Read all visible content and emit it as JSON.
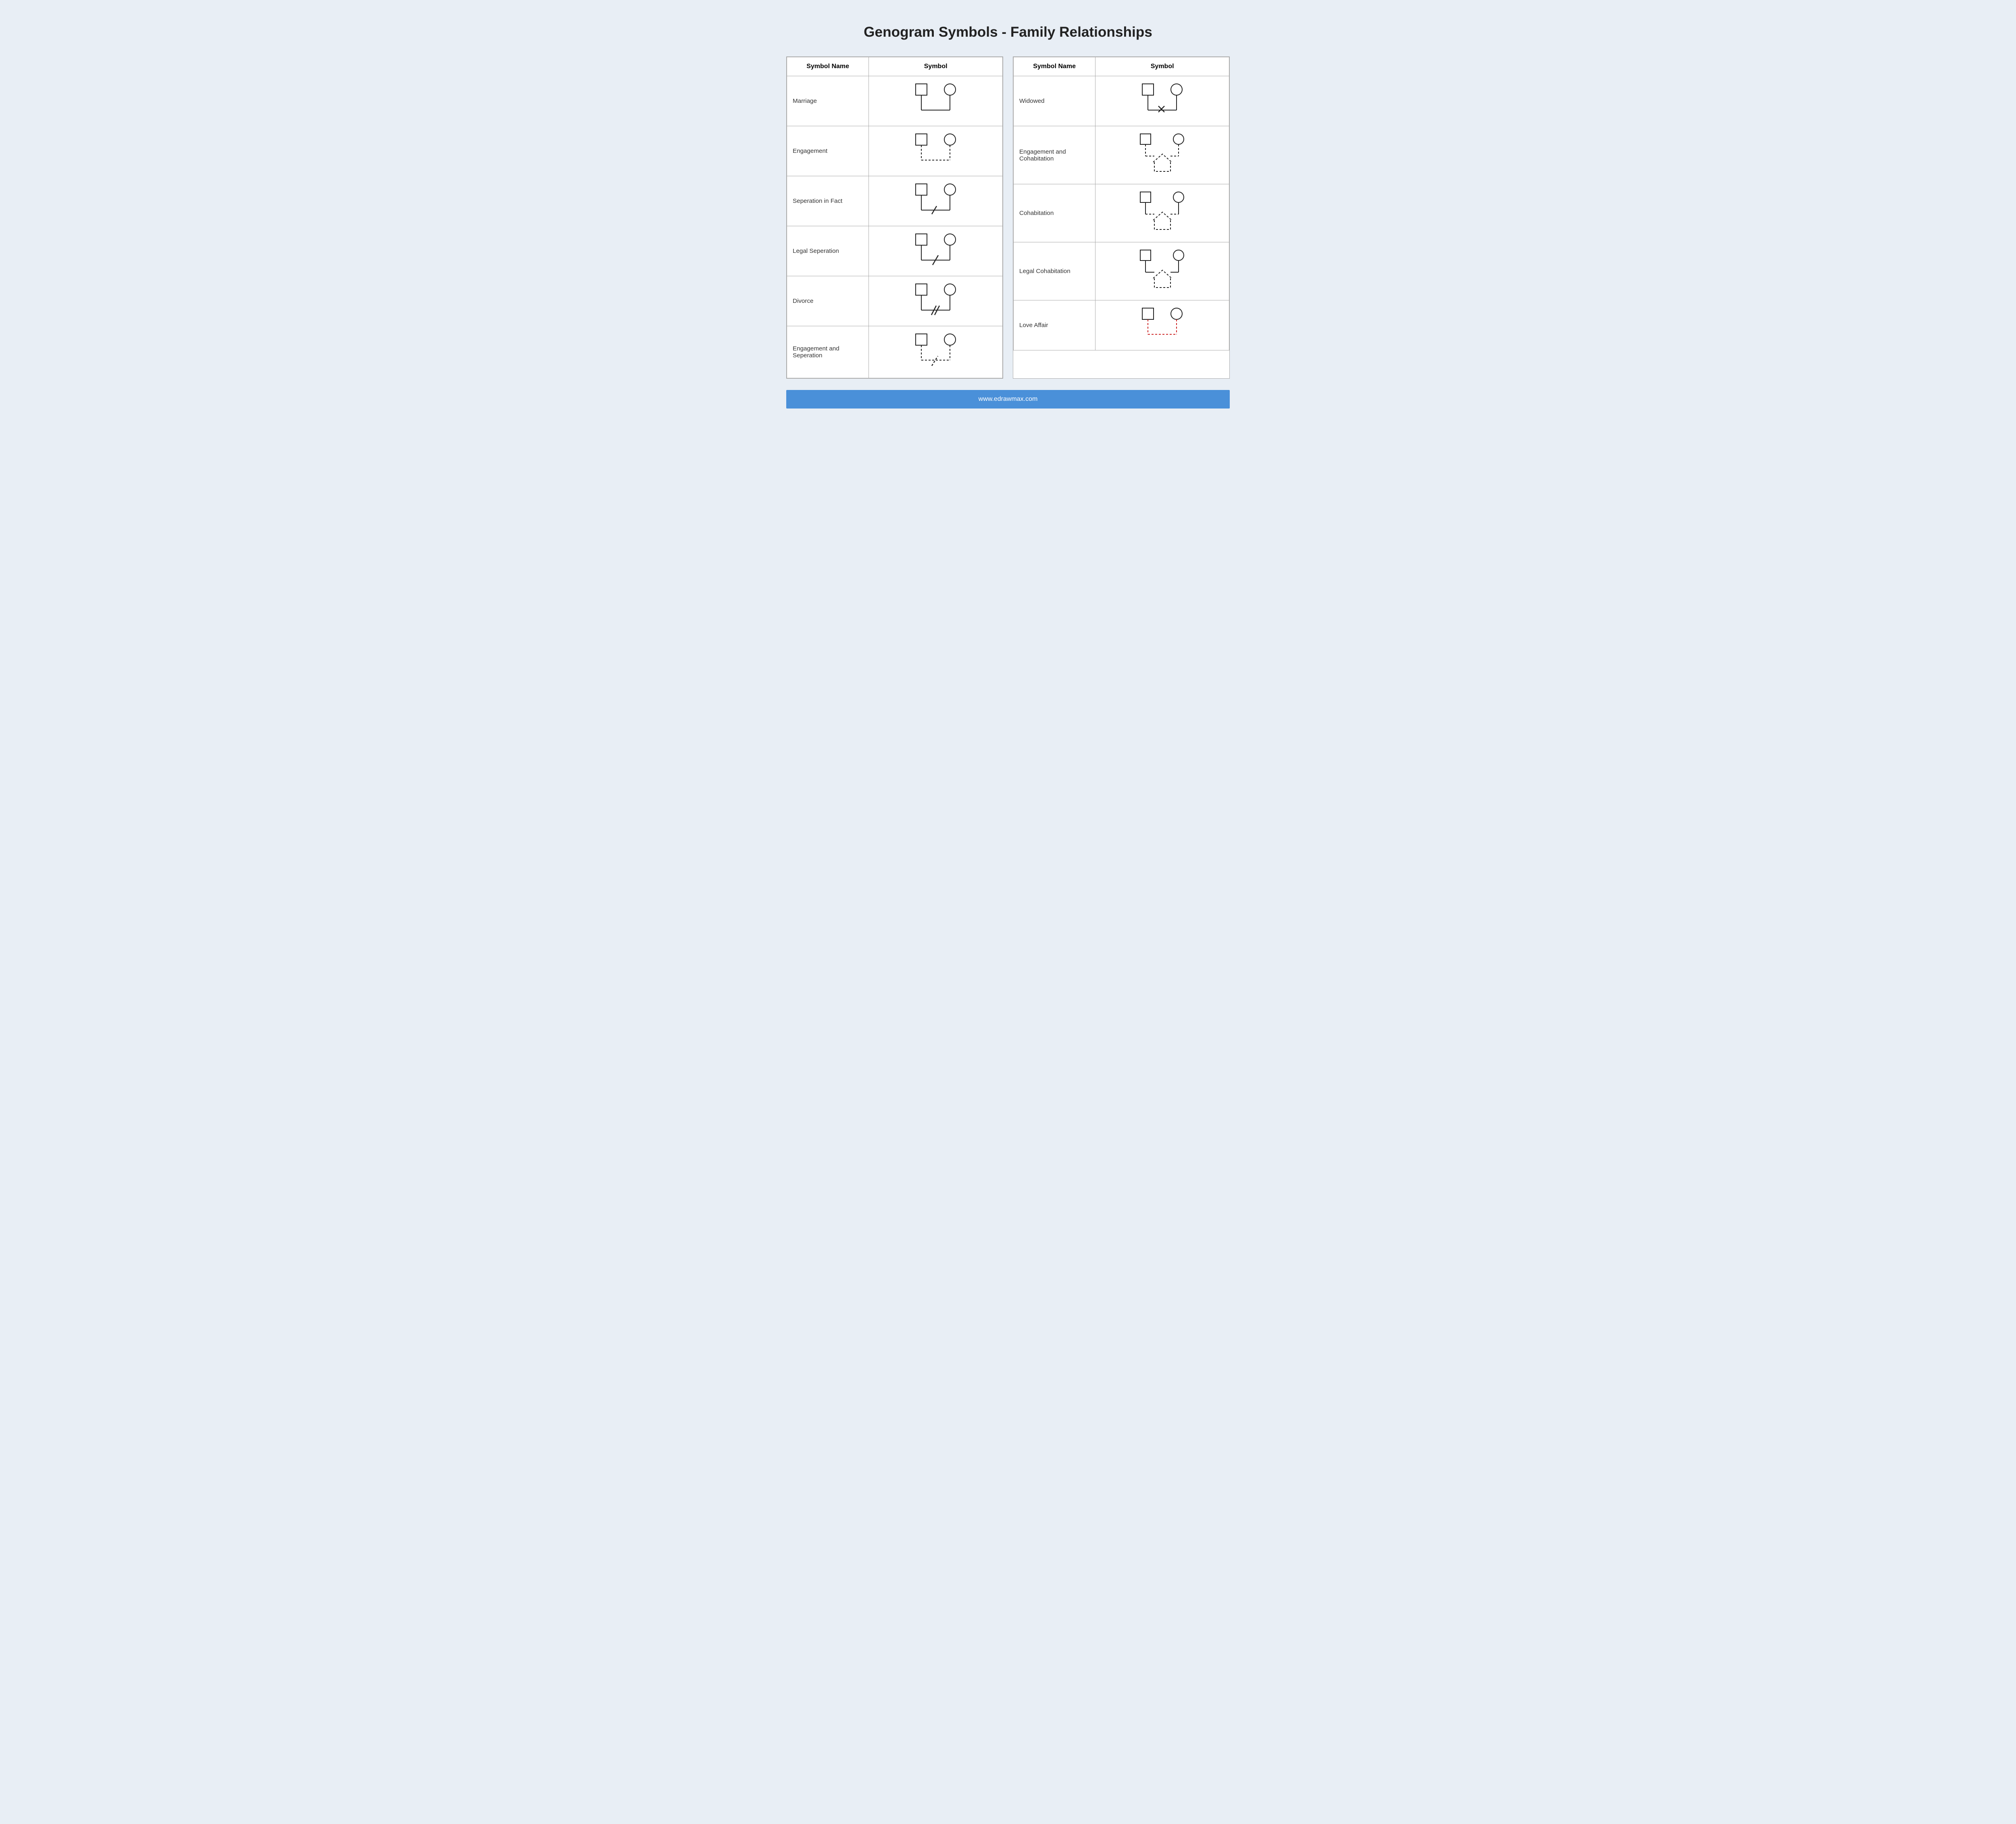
{
  "page": {
    "title": "Genogram Symbols - Family Relationships",
    "footer": "www.edrawmax.com"
  },
  "left_table": {
    "col1_header": "Symbol Name",
    "col2_header": "Symbol",
    "rows": [
      {
        "name": "Marriage"
      },
      {
        "name": "Engagement"
      },
      {
        "name": "Seperation in Fact"
      },
      {
        "name": "Legal Seperation"
      },
      {
        "name": "Divorce"
      },
      {
        "name": "Engagement and Seperation"
      }
    ]
  },
  "right_table": {
    "col1_header": "Symbol Name",
    "col2_header": "Symbol",
    "rows": [
      {
        "name": "Widowed"
      },
      {
        "name": "Engagement and Cohabitation"
      },
      {
        "name": "Cohabitation"
      },
      {
        "name": "Legal Cohabitation"
      },
      {
        "name": "Love Affair"
      }
    ]
  }
}
